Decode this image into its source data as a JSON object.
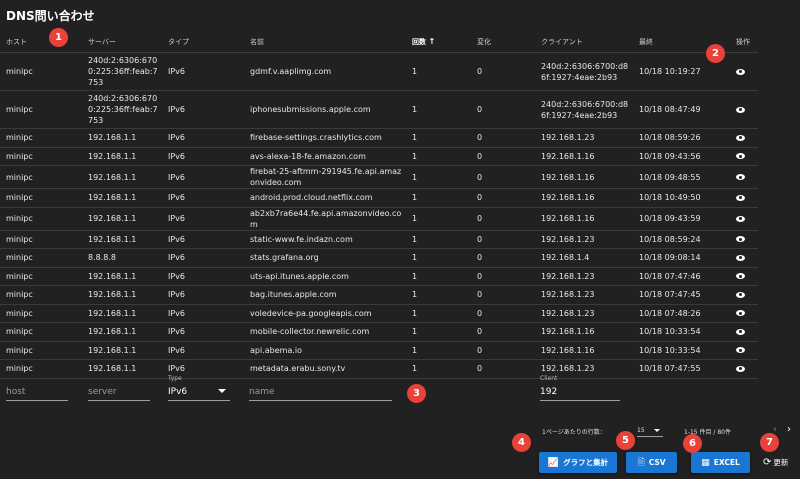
{
  "page": {
    "title": "DNS問い合わせ"
  },
  "table": {
    "headers": {
      "host": "ホスト",
      "server": "サーバー",
      "type": "タイプ",
      "name": "名前",
      "count": "回数",
      "sort_icon": "↑",
      "change": "変化",
      "client": "クライアント",
      "last": "最終",
      "action": "操作"
    },
    "rows": [
      {
        "host": "minipc",
        "server": "240d:2:6306:6700:225:36ff:feab:7753",
        "type": "IPv6",
        "name": "gdmf.v.aaplimg.com",
        "count": "1",
        "change": "0",
        "client": "240d:2:6306:6700:d86f:1927:4eae:2b93",
        "last": "10/18 10:19:27"
      },
      {
        "host": "minipc",
        "server": "240d:2:6306:6700:225:36ff:feab:7753",
        "type": "IPv6",
        "name": "iphonesubmissions.apple.com",
        "count": "1",
        "change": "0",
        "client": "240d:2:6306:6700:d86f:1927:4eae:2b93",
        "last": "10/18 08:47:49"
      },
      {
        "host": "minipc",
        "server": "192.168.1.1",
        "type": "IPv6",
        "name": "firebase-settings.crashlytics.com",
        "count": "1",
        "change": "0",
        "client": "192.168.1.23",
        "last": "10/18 08:59:26"
      },
      {
        "host": "minipc",
        "server": "192.168.1.1",
        "type": "IPv6",
        "name": "avs-alexa-18-fe.amazon.com",
        "count": "1",
        "change": "0",
        "client": "192.168.1.16",
        "last": "10/18 09:43:56"
      },
      {
        "host": "minipc",
        "server": "192.168.1.1",
        "type": "IPv6",
        "name": "firebat-25-aftmm-291945.fe.api.amazonvideo.com",
        "count": "1",
        "change": "0",
        "client": "192.168.1.16",
        "last": "10/18 09:48:55"
      },
      {
        "host": "minipc",
        "server": "192.168.1.1",
        "type": "IPv6",
        "name": "android.prod.cloud.netflix.com",
        "count": "1",
        "change": "0",
        "client": "192.168.1.16",
        "last": "10/18 10:49:50"
      },
      {
        "host": "minipc",
        "server": "192.168.1.1",
        "type": "IPv6",
        "name": "ab2xb7ra6e44.fe.api.amazonvideo.com",
        "count": "1",
        "change": "0",
        "client": "192.168.1.16",
        "last": "10/18 09:43:59"
      },
      {
        "host": "minipc",
        "server": "192.168.1.1",
        "type": "IPv6",
        "name": "static-www.fe.indazn.com",
        "count": "1",
        "change": "0",
        "client": "192.168.1.23",
        "last": "10/18 08:59:24"
      },
      {
        "host": "minipc",
        "server": "8.8.8.8",
        "type": "IPv6",
        "name": "stats.grafana.org",
        "count": "1",
        "change": "0",
        "client": "192.168.1.4",
        "last": "10/18 09:08:14"
      },
      {
        "host": "minipc",
        "server": "192.168.1.1",
        "type": "IPv6",
        "name": "uts-api.itunes.apple.com",
        "count": "1",
        "change": "0",
        "client": "192.168.1.23",
        "last": "10/18 07:47:46"
      },
      {
        "host": "minipc",
        "server": "192.168.1.1",
        "type": "IPv6",
        "name": "bag.itunes.apple.com",
        "count": "1",
        "change": "0",
        "client": "192.168.1.23",
        "last": "10/18 07:47:45"
      },
      {
        "host": "minipc",
        "server": "192.168.1.1",
        "type": "IPv6",
        "name": "voledevice-pa.googleapis.com",
        "count": "1",
        "change": "0",
        "client": "192.168.1.23",
        "last": "10/18 07:48:26"
      },
      {
        "host": "minipc",
        "server": "192.168.1.1",
        "type": "IPv6",
        "name": "mobile-collector.newrelic.com",
        "count": "1",
        "change": "0",
        "client": "192.168.1.16",
        "last": "10/18 10:33:54"
      },
      {
        "host": "minipc",
        "server": "192.168.1.1",
        "type": "IPv6",
        "name": "api.abema.io",
        "count": "1",
        "change": "0",
        "client": "192.168.1.16",
        "last": "10/18 10:33:54"
      },
      {
        "host": "minipc",
        "server": "192.168.1.1",
        "type": "IPv6",
        "name": "metadata.erabu.sony.tv",
        "count": "1",
        "change": "0",
        "client": "192.168.1.23",
        "last": "10/18 07:47:55"
      }
    ],
    "action_icon": "eye-icon"
  },
  "filters": {
    "host_placeholder": "host",
    "server_placeholder": "server",
    "type_label": "Type",
    "type_value": "IPv6",
    "name_placeholder": "name",
    "client_label": "Client",
    "client_value": "192"
  },
  "pagination": {
    "rows_per_page_label": "1ページあたりの行数：",
    "rows_per_page_value": "15",
    "range": "1-15 件目 / 80件",
    "prev": "‹",
    "next": "›"
  },
  "buttons": {
    "chart_label": "グラフと集計",
    "csv_label": "CSV",
    "excel_label": "EXCEL",
    "refresh_label": "更新"
  },
  "badges": [
    "1",
    "2",
    "3",
    "4",
    "5",
    "6",
    "7"
  ],
  "colors": {
    "background": "#212121",
    "primary": "#1976d2",
    "badge": "#e8423a"
  }
}
